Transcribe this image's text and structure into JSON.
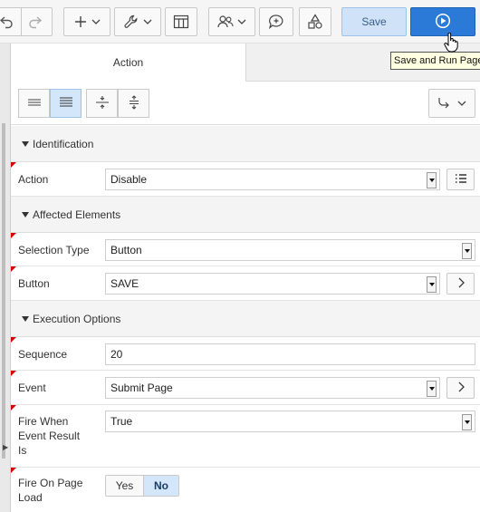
{
  "toolbar": {
    "save_label": "Save",
    "tooltip": "Save and Run Page",
    "icons": [
      "undo-icon",
      "redo-icon",
      "plus-icon",
      "chevron-down-icon",
      "wrench-icon",
      "grid-icon",
      "shared-components-icon",
      "comment-icon",
      "shapes-icon",
      "run-icon"
    ]
  },
  "tabs": {
    "active": "Action"
  },
  "sections": {
    "identification": "Identification",
    "affected": "Affected Elements",
    "execution": "Execution Options"
  },
  "fields": {
    "action": {
      "label": "Action",
      "value": "Disable"
    },
    "selection_type": {
      "label": "Selection Type",
      "value": "Button"
    },
    "button": {
      "label": "Button",
      "value": "SAVE"
    },
    "sequence": {
      "label": "Sequence",
      "value": "20"
    },
    "event": {
      "label": "Event",
      "value": "Submit Page"
    },
    "fire_when": {
      "label": "Fire When Event Result Is",
      "value": "True"
    },
    "fire_on_load": {
      "label": "Fire On Page Load",
      "yes": "Yes",
      "no": "No",
      "selected": "No"
    }
  },
  "colors": {
    "accent": "#2c7ad8",
    "save_bg": "#cfe2f7",
    "required_marker": "#d40000"
  }
}
